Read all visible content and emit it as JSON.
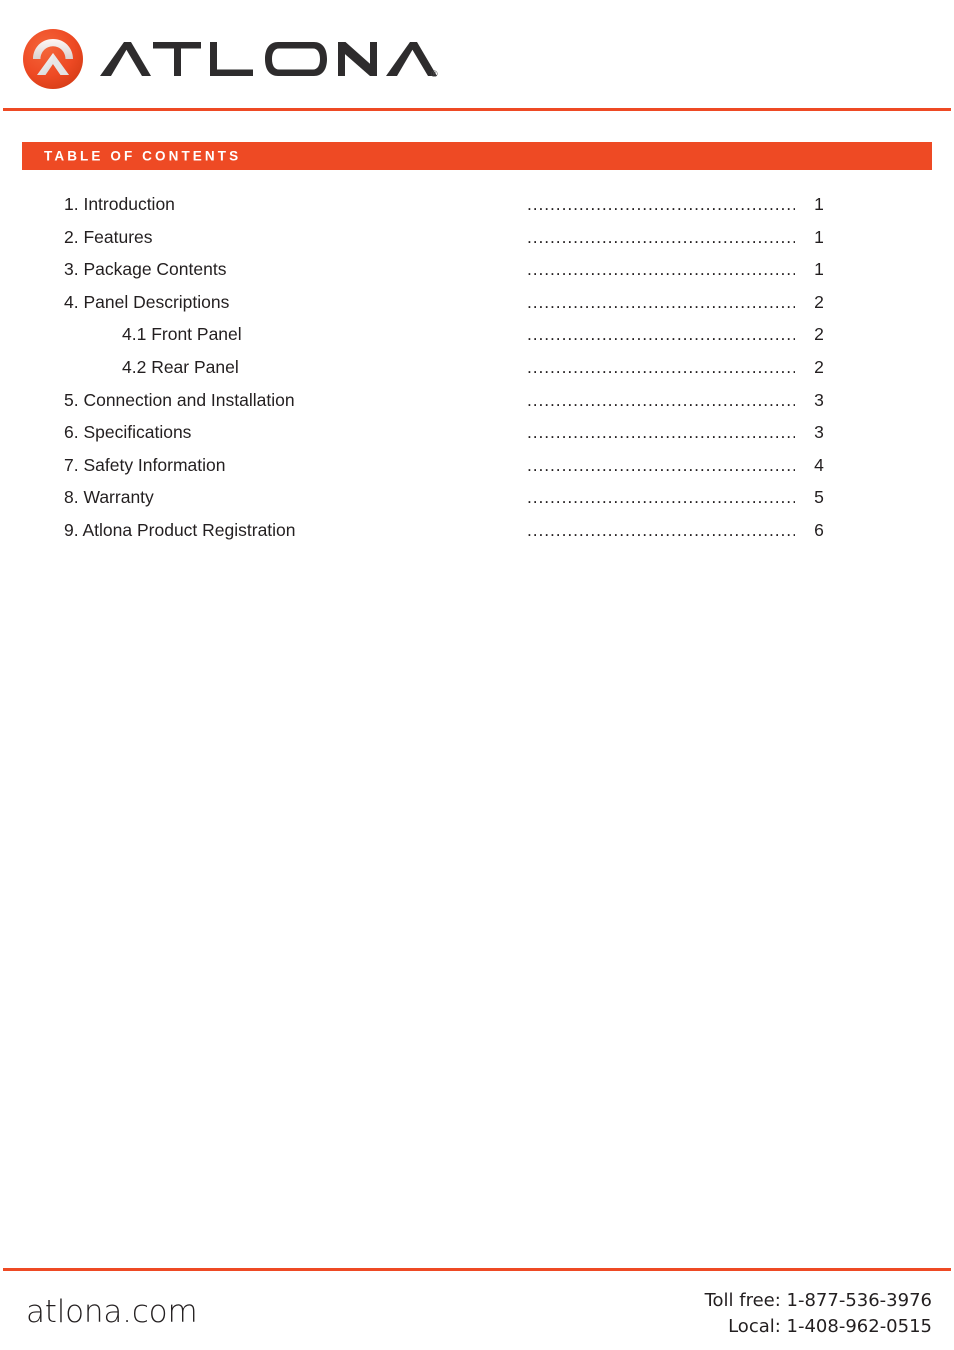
{
  "brand": {
    "logo_icon": "atlona-chevron-circle-icon",
    "wordmark": "ATLONA",
    "registered_mark": "®",
    "accent_color": "#EE4A24",
    "wordmark_color": "#231F20"
  },
  "section": {
    "title": "TABLE OF CONTENTS"
  },
  "toc": {
    "entries": [
      {
        "label": "1. Introduction",
        "page": "1",
        "leader": "..................................................",
        "sub": false
      },
      {
        "label": "2. Features",
        "page": "1",
        "leader": "..................................................",
        "sub": false
      },
      {
        "label": "3. Package Contents",
        "page": "1",
        "leader": "..................................................",
        "sub": false
      },
      {
        "label": "4. Panel Descriptions",
        "page": "2",
        "leader": "..................................................",
        "sub": false
      },
      {
        "label": "4.1 Front Panel",
        "page": "2",
        "leader": "..................................................",
        "sub": true
      },
      {
        "label": "4.2 Rear Panel",
        "page": "2",
        "leader": "..................................................",
        "sub": true
      },
      {
        "label": "5. Connection and Installation",
        "page": "3",
        "leader": "..................................................",
        "sub": false
      },
      {
        "label": "6. Specifications",
        "page": "3",
        "leader": "..................................................",
        "sub": false
      },
      {
        "label": "7. Safety Information",
        "page": "4",
        "leader": "..................................................",
        "sub": false
      },
      {
        "label": "8. Warranty",
        "page": "5",
        "leader": "..................................................",
        "sub": false
      },
      {
        "label": "9. Atlona Product Registration",
        "page": "6",
        "leader": "..................................................",
        "sub": false
      }
    ]
  },
  "footer": {
    "site": "atlona.com",
    "toll_free": "Toll free: 1-877-536-3976",
    "local": "Local: 1-408-962-0515"
  }
}
